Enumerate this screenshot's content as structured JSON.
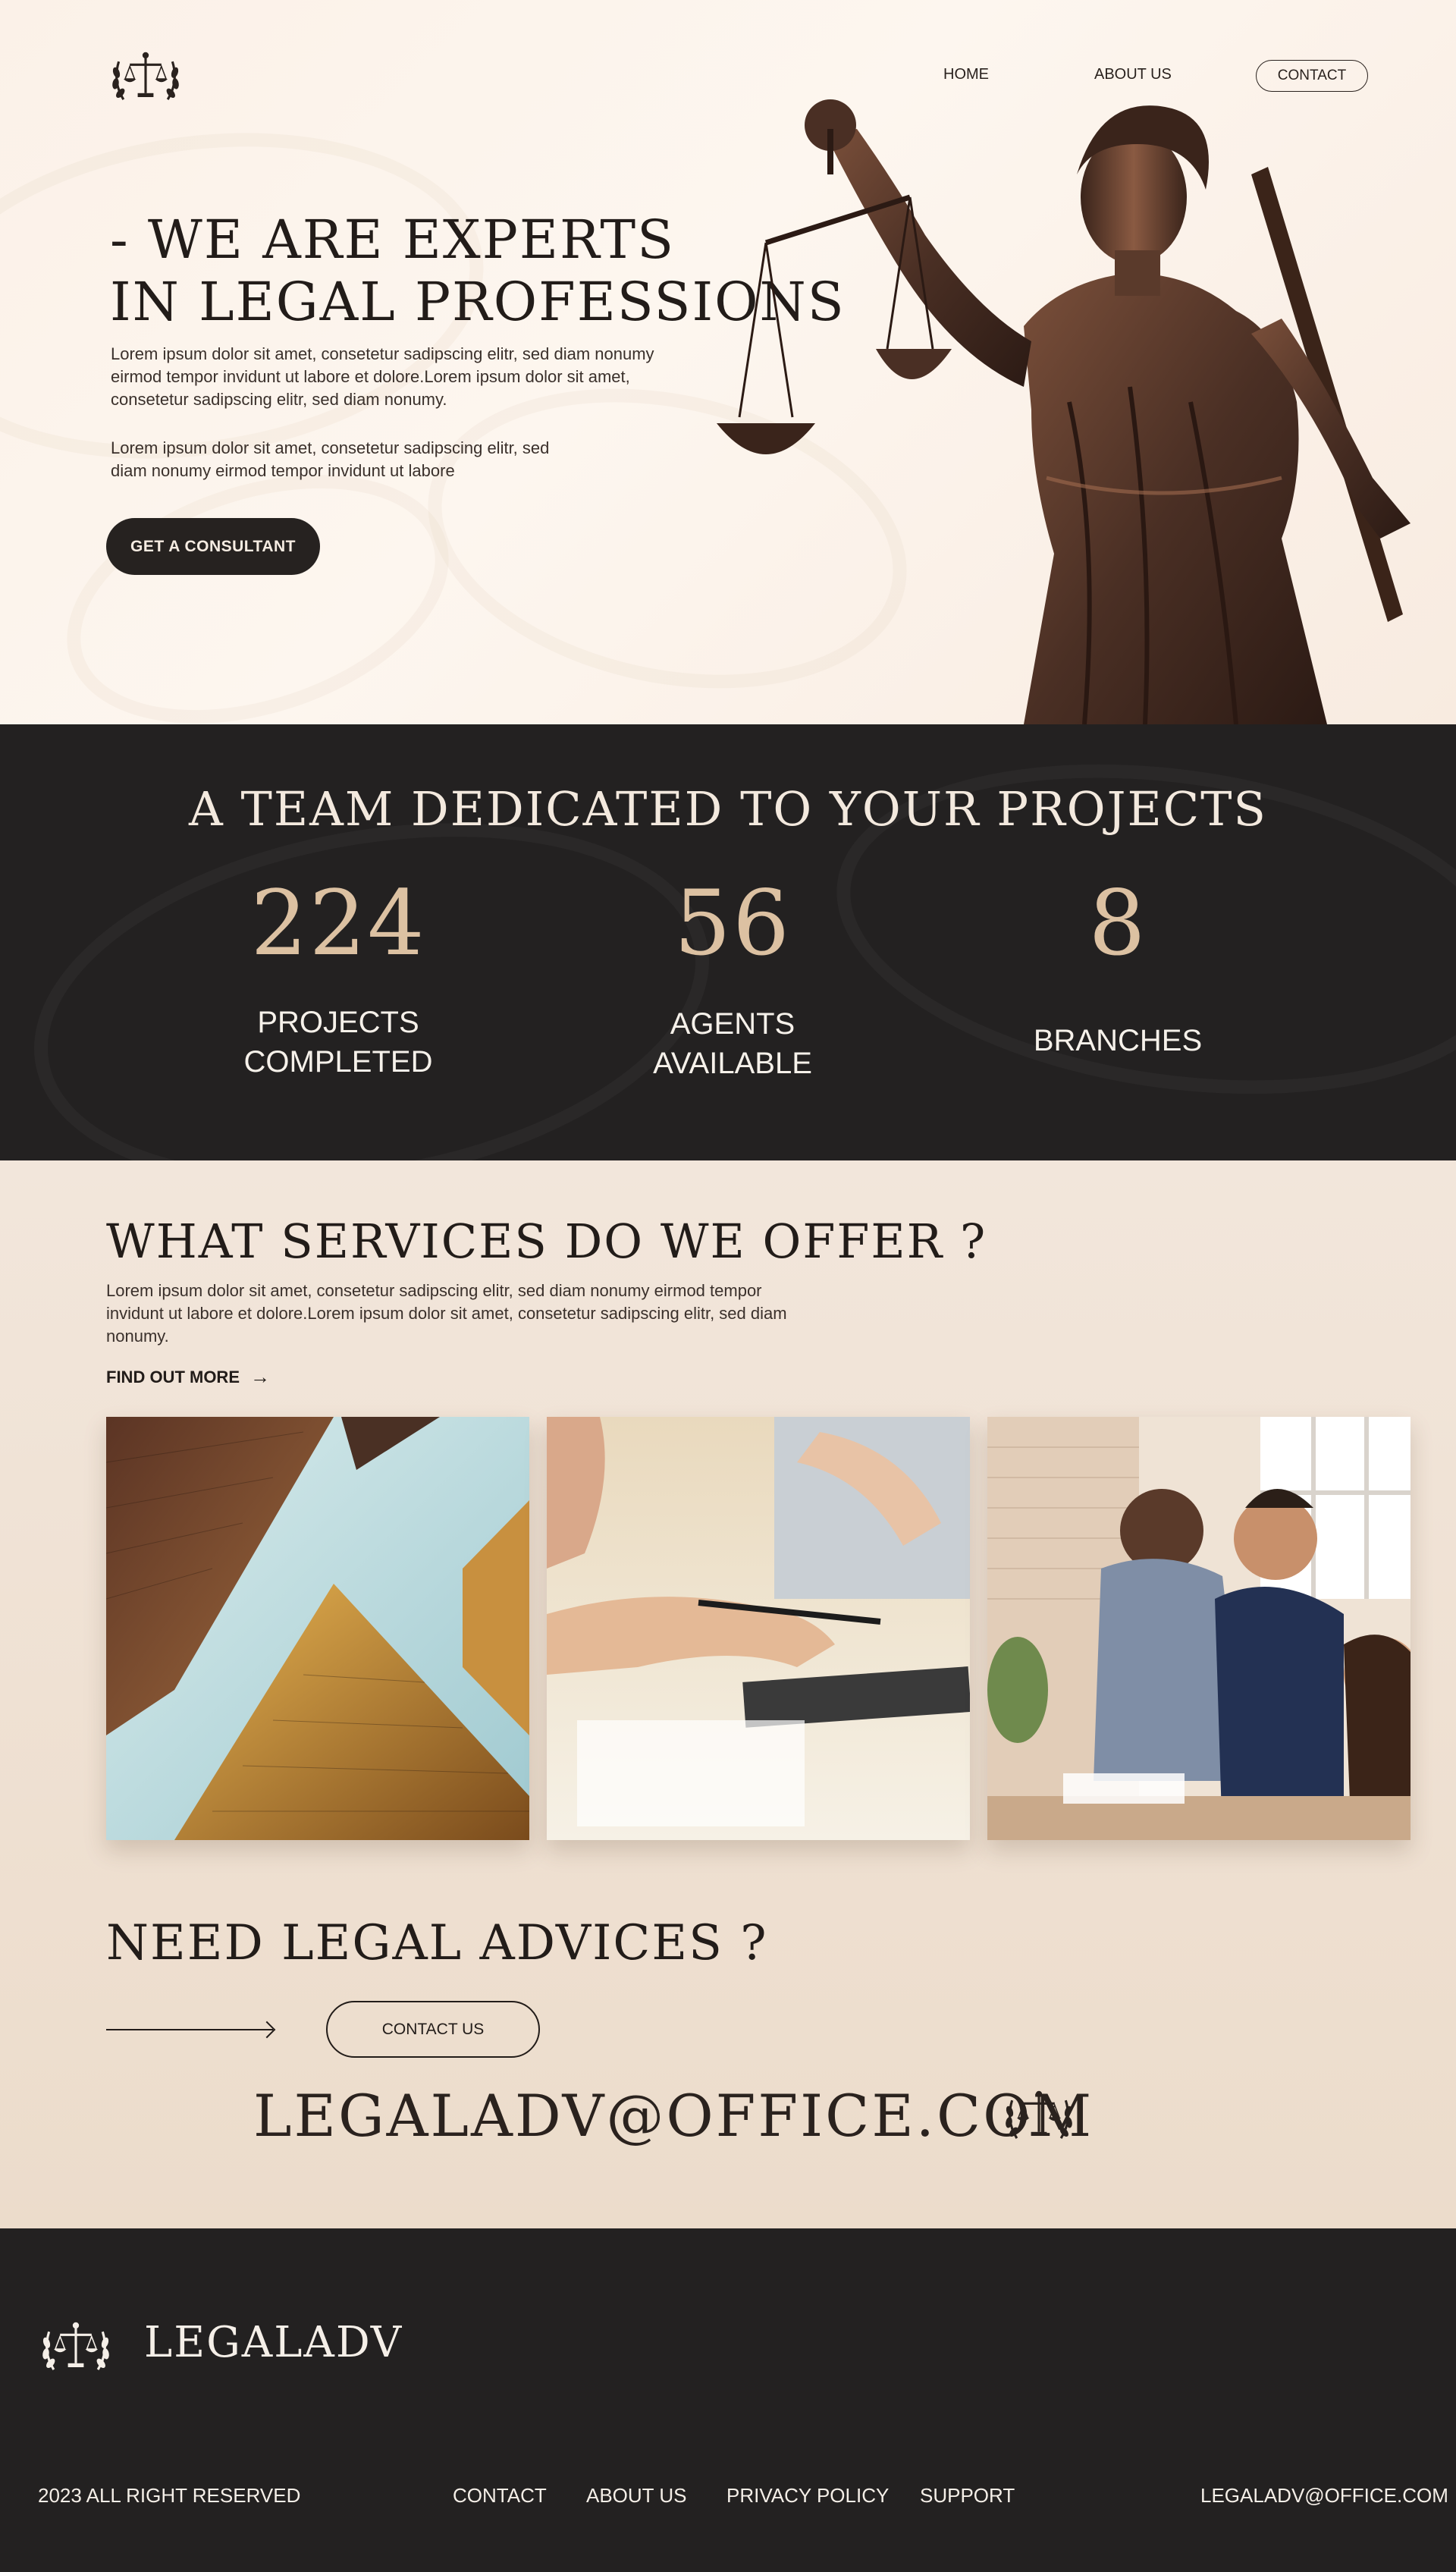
{
  "nav": {
    "home": "HOME",
    "about": "ABOUT US",
    "contact": "CONTACT"
  },
  "hero": {
    "title_line1": "- WE ARE EXPERTS",
    "title_line2": "IN LEGAL PROFESSIONS",
    "p1_line1": "Lorem ipsum dolor sit amet, consetetur sadipscing elitr, sed diam nonumy",
    "p1_line2": "eirmod tempor invidunt ut labore et dolore.Lorem ipsum dolor sit amet,",
    "p1_line3": "consetetur sadipscing elitr, sed diam nonumy.",
    "p2_line1": "Lorem ipsum dolor sit amet, consetetur sadipscing elitr, sed",
    "p2_line2": "diam nonumy eirmod tempor invidunt ut labore",
    "cta": "GET A CONSULTANT"
  },
  "stats": {
    "title": "A TEAM DEDICATED TO YOUR PROJECTS",
    "items": [
      {
        "number": "224",
        "label_line1": "PROJECTS",
        "label_line2": "COMPLETED"
      },
      {
        "number": "56",
        "label_line1": "AGENTS",
        "label_line2": "AVAILABLE"
      },
      {
        "number": "8",
        "label_line1": "BRANCHES",
        "label_line2": ""
      }
    ]
  },
  "services": {
    "title": "WHAT SERVICES DO WE OFFER ?",
    "p_line1": "Lorem ipsum dolor sit amet, consetetur sadipscing elitr, sed diam nonumy eirmod tempor",
    "p_line2": "invidunt ut labore et dolore.Lorem ipsum dolor sit amet, consetetur sadipscing elitr, sed diam",
    "p_line3": "nonumy.",
    "find_more": "FIND OUT MORE",
    "arrow_icon": "→"
  },
  "advice": {
    "title": "NEED LEGAL ADVICES ?",
    "button": "CONTACT US",
    "email": "LEGALADV@OFFICE.COM"
  },
  "footer": {
    "brand": "LEGALADV",
    "copyright": "2023 ALL RIGHT RESERVED",
    "links": [
      "CONTACT",
      "ABOUT US",
      "PRIVACY POLICY",
      "SUPPORT"
    ],
    "email": "LEGALADV@OFFICE.COM"
  },
  "colors": {
    "dark": "#232121",
    "accent": "#dcc1a2",
    "cream": "#fbf1e8"
  }
}
